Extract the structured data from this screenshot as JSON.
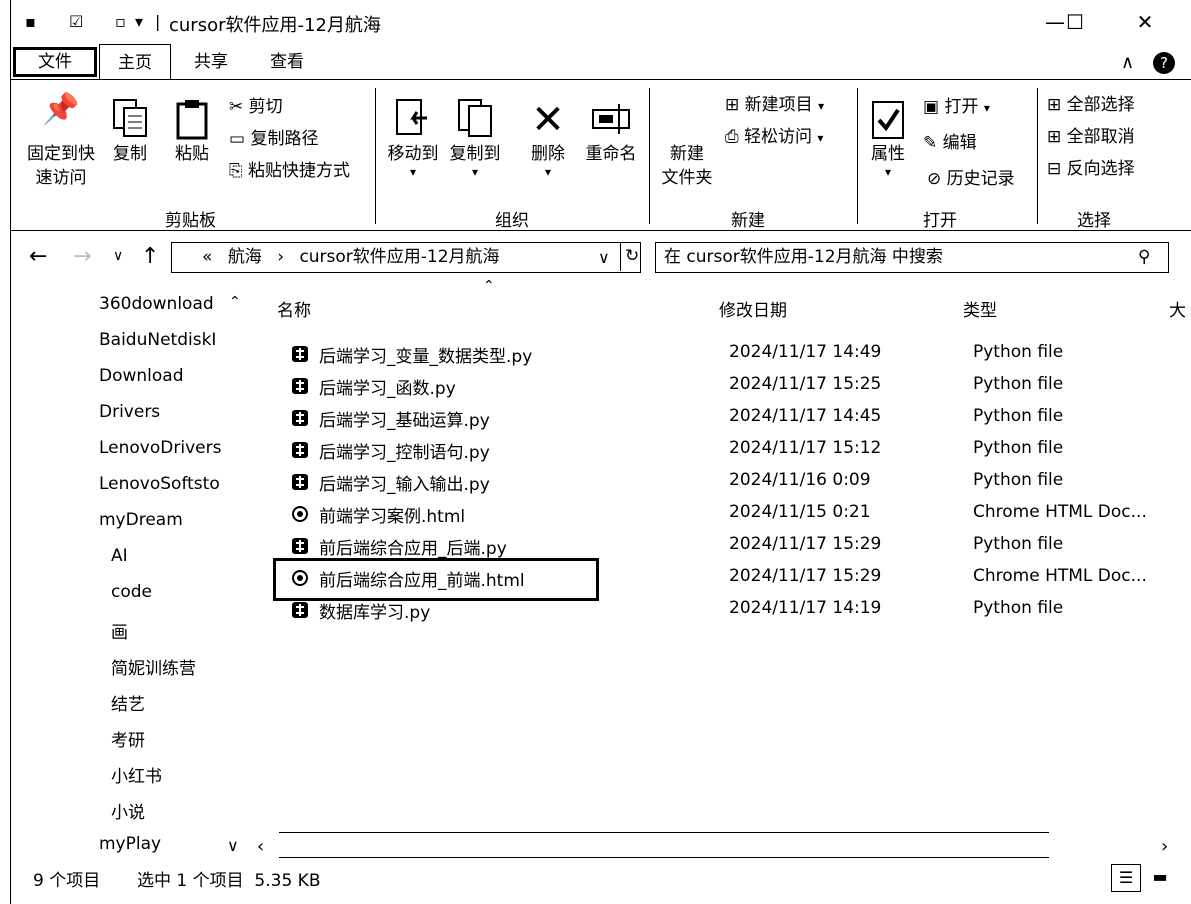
{
  "window": {
    "title": "cursor软件应用-12月航海",
    "minimize": "—",
    "maximize": "☐",
    "close": "✕"
  },
  "ribbon_tabs": {
    "file": "文件",
    "home": "主页",
    "share": "共享",
    "view": "查看"
  },
  "ribbon": {
    "pin": [
      "固定到快",
      "速访问"
    ],
    "copy": "复制",
    "paste": "粘贴",
    "cut": "剪切",
    "copy_path": "复制路径",
    "paste_shortcut": "粘贴快捷方式",
    "move_to": "移动到",
    "copy_to": "复制到",
    "delete": "删除",
    "rename": "重命名",
    "new_folder": [
      "新建",
      "文件夹"
    ],
    "new_item": "新建项目",
    "easy_access": "轻松访问",
    "properties": "属性",
    "open": "打开",
    "edit": "编辑",
    "history": "历史记录",
    "select_all": "全部选择",
    "select_none": "全部取消",
    "invert_selection": "反向选择",
    "groups": {
      "clipboard": "剪贴板",
      "organize": "组织",
      "new": "新建",
      "open": "打开",
      "select": "选择"
    }
  },
  "navbar": {
    "address_prefix": "«",
    "crumb1": "航海",
    "crumb_sep": "›",
    "crumb2": "cursor软件应用-12月航海",
    "search_placeholder": "在 cursor软件应用-12月航海 中搜索"
  },
  "nav_pane": [
    {
      "label": "360download",
      "indent": 0
    },
    {
      "label": "BaiduNetdiskI",
      "indent": 0
    },
    {
      "label": "Download",
      "indent": 0
    },
    {
      "label": "Drivers",
      "indent": 0
    },
    {
      "label": "LenovoDrivers",
      "indent": 0
    },
    {
      "label": "LenovoSoftsto",
      "indent": 0
    },
    {
      "label": "myDream",
      "indent": 0
    },
    {
      "label": "AI",
      "indent": 1
    },
    {
      "label": "code",
      "indent": 1
    },
    {
      "label": "画",
      "indent": 1
    },
    {
      "label": "简妮训练营",
      "indent": 1
    },
    {
      "label": "结艺",
      "indent": 1
    },
    {
      "label": "考研",
      "indent": 1
    },
    {
      "label": "小红书",
      "indent": 1
    },
    {
      "label": "小说",
      "indent": 1
    },
    {
      "label": "myPlay",
      "indent": 0
    }
  ],
  "columns": {
    "name": "名称",
    "modified": "修改日期",
    "type": "类型",
    "size": "大"
  },
  "files": [
    {
      "name": "后端学习_变量_数据类型.py",
      "date": "2024/11/17 14:49",
      "type": "Python file",
      "icon": "python-icon"
    },
    {
      "name": "后端学习_函数.py",
      "date": "2024/11/17 15:25",
      "type": "Python file",
      "icon": "python-icon"
    },
    {
      "name": "后端学习_基础运算.py",
      "date": "2024/11/17 14:45",
      "type": "Python file",
      "icon": "python-icon"
    },
    {
      "name": "后端学习_控制语句.py",
      "date": "2024/11/17 15:12",
      "type": "Python file",
      "icon": "python-icon"
    },
    {
      "name": "后端学习_输入输出.py",
      "date": "2024/11/16 0:09",
      "type": "Python file",
      "icon": "python-icon"
    },
    {
      "name": "前端学习案例.html",
      "date": "2024/11/15 0:21",
      "type": "Chrome HTML Doc...",
      "icon": "chrome-icon"
    },
    {
      "name": "前后端综合应用_后端.py",
      "date": "2024/11/17 15:29",
      "type": "Python file",
      "icon": "python-icon"
    },
    {
      "name": "前后端综合应用_前端.html",
      "date": "2024/11/17 15:29",
      "type": "Chrome HTML Doc...",
      "icon": "chrome-icon"
    },
    {
      "name": "数据库学习.py",
      "date": "2024/11/17 14:19",
      "type": "Python file",
      "icon": "python-icon"
    }
  ],
  "status": {
    "count": "9 个项目",
    "selected": "选中 1 个项目  5.35 KB"
  }
}
